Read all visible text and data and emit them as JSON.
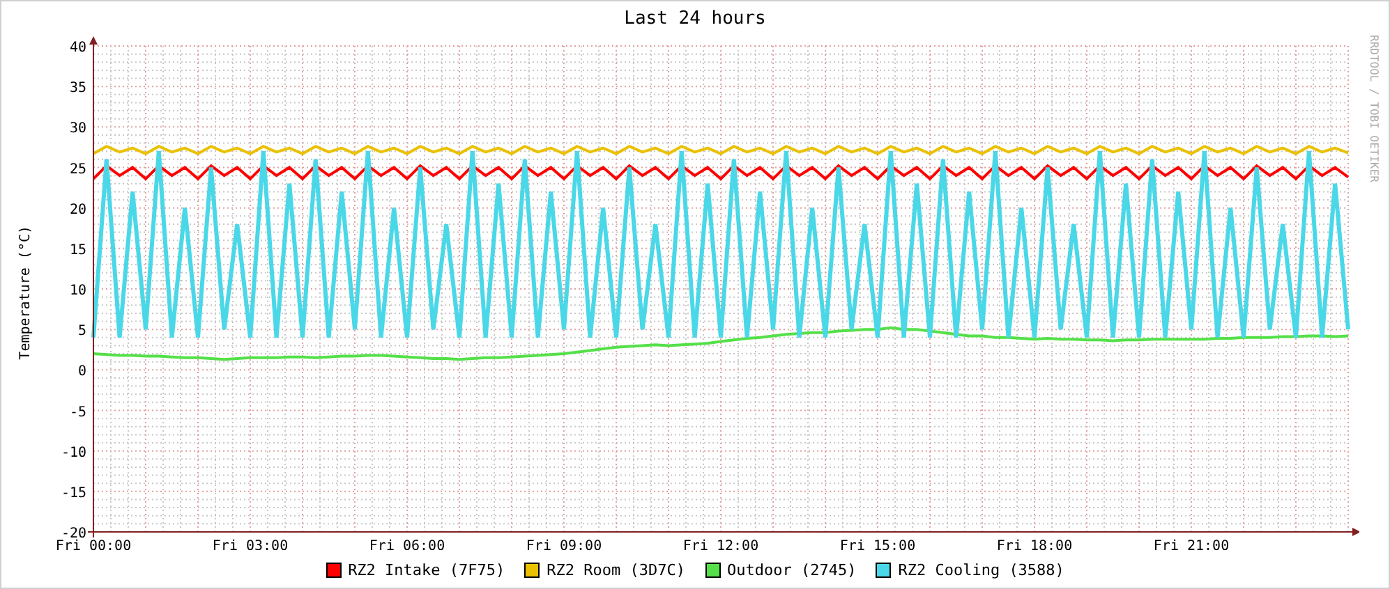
{
  "graph": {
    "credit": "RRDTOOL / TOBI OETIKER",
    "chart_data": {
      "type": "line",
      "title": "Last 24 hours",
      "ylabel": "Temperature (°C)",
      "categories": [
        "Fri 00:00",
        null,
        null,
        null,
        null,
        null,
        null,
        null,
        null,
        null,
        null,
        null,
        "Fri 03:00",
        null,
        null,
        null,
        null,
        null,
        null,
        null,
        null,
        null,
        null,
        null,
        "Fri 06:00",
        null,
        null,
        null,
        null,
        null,
        null,
        null,
        null,
        null,
        null,
        null,
        "Fri 09:00",
        null,
        null,
        null,
        null,
        null,
        null,
        null,
        null,
        null,
        null,
        null,
        "Fri 12:00",
        null,
        null,
        null,
        null,
        null,
        null,
        null,
        null,
        null,
        null,
        null,
        "Fri 15:00",
        null,
        null,
        null,
        null,
        null,
        null,
        null,
        null,
        null,
        null,
        null,
        "Fri 18:00",
        null,
        null,
        null,
        null,
        null,
        null,
        null,
        null,
        null,
        null,
        null,
        "Fri 21:00",
        null,
        null,
        null,
        null,
        null,
        null,
        null,
        null,
        null,
        null,
        null,
        null
      ],
      "ylim": [
        -20,
        40
      ],
      "grid": true,
      "yticks": [
        -20,
        -15,
        -10,
        -5,
        0,
        5,
        10,
        15,
        20,
        25,
        30,
        35,
        40
      ],
      "series": [
        {
          "name": "RZ2 Intake (7F75)",
          "color": "#ff0000",
          "values": [
            23.6,
            25.2,
            24.0,
            25.0,
            23.6,
            25.2,
            24.0,
            25.0,
            23.6,
            25.2,
            24.0,
            25.0,
            23.6,
            25.2,
            24.0,
            25.0,
            23.6,
            25.2,
            24.0,
            25.0,
            23.6,
            25.2,
            24.0,
            25.0,
            23.6,
            25.2,
            24.0,
            25.0,
            23.6,
            25.2,
            24.0,
            25.0,
            23.6,
            25.2,
            24.0,
            25.0,
            23.6,
            25.2,
            24.0,
            25.0,
            23.6,
            25.2,
            24.0,
            25.0,
            23.6,
            25.2,
            24.0,
            25.0,
            23.6,
            25.2,
            24.0,
            25.0,
            23.6,
            25.2,
            24.0,
            25.0,
            23.6,
            25.2,
            24.0,
            25.0,
            23.6,
            25.2,
            24.0,
            25.0,
            23.6,
            25.2,
            24.0,
            25.0,
            23.6,
            25.2,
            24.0,
            25.0,
            23.6,
            25.2,
            24.0,
            25.0,
            23.6,
            25.2,
            24.0,
            25.0,
            23.6,
            25.2,
            24.0,
            25.0,
            23.6,
            25.2,
            24.0,
            25.0,
            23.6,
            25.2,
            24.0,
            25.0,
            23.6,
            25.2,
            24.0,
            25.0,
            23.8
          ]
        },
        {
          "name": "RZ2 Room (3D7C)",
          "color": "#eac100",
          "values": [
            26.7,
            27.6,
            26.9,
            27.4,
            26.7,
            27.6,
            26.9,
            27.4,
            26.7,
            27.6,
            26.9,
            27.4,
            26.7,
            27.6,
            26.9,
            27.4,
            26.7,
            27.6,
            26.9,
            27.4,
            26.7,
            27.6,
            26.9,
            27.4,
            26.7,
            27.6,
            26.9,
            27.4,
            26.7,
            27.6,
            26.9,
            27.4,
            26.7,
            27.6,
            26.9,
            27.4,
            26.7,
            27.6,
            26.9,
            27.4,
            26.7,
            27.6,
            26.9,
            27.4,
            26.7,
            27.6,
            26.9,
            27.4,
            26.7,
            27.6,
            26.9,
            27.4,
            26.7,
            27.6,
            26.9,
            27.4,
            26.7,
            27.6,
            26.9,
            27.4,
            26.7,
            27.6,
            26.9,
            27.4,
            26.7,
            27.6,
            26.9,
            27.4,
            26.7,
            27.6,
            26.9,
            27.4,
            26.7,
            27.6,
            26.9,
            27.4,
            26.7,
            27.6,
            26.9,
            27.4,
            26.7,
            27.6,
            26.9,
            27.4,
            26.7,
            27.6,
            26.9,
            27.4,
            26.7,
            27.6,
            26.9,
            27.4,
            26.7,
            27.6,
            26.9,
            27.4,
            26.8
          ]
        },
        {
          "name": "Outdoor (2745)",
          "color": "#54e048",
          "values": [
            2.0,
            1.9,
            1.8,
            1.8,
            1.7,
            1.7,
            1.6,
            1.5,
            1.5,
            1.4,
            1.3,
            1.4,
            1.5,
            1.5,
            1.5,
            1.6,
            1.6,
            1.5,
            1.6,
            1.7,
            1.7,
            1.8,
            1.8,
            1.7,
            1.6,
            1.5,
            1.4,
            1.4,
            1.3,
            1.4,
            1.5,
            1.5,
            1.6,
            1.7,
            1.8,
            1.9,
            2.0,
            2.2,
            2.4,
            2.6,
            2.8,
            2.9,
            3.0,
            3.1,
            3.0,
            3.1,
            3.2,
            3.3,
            3.5,
            3.7,
            3.9,
            4.0,
            4.2,
            4.4,
            4.5,
            4.6,
            4.6,
            4.8,
            4.9,
            5.0,
            5.0,
            5.2,
            5.0,
            5.0,
            4.8,
            4.6,
            4.4,
            4.2,
            4.2,
            4.0,
            4.0,
            3.9,
            3.8,
            3.9,
            3.8,
            3.8,
            3.7,
            3.7,
            3.6,
            3.7,
            3.7,
            3.8,
            3.8,
            3.8,
            3.8,
            3.8,
            3.9,
            3.9,
            4.0,
            4.0,
            4.0,
            4.1,
            4.1,
            4.2,
            4.2,
            4.1,
            4.2
          ]
        },
        {
          "name": "RZ2 Cooling (3588)",
          "color": "#4ad8e8",
          "values": [
            4,
            26,
            4,
            22,
            5,
            27,
            4,
            20,
            4,
            25,
            5,
            18,
            4,
            27,
            4,
            23,
            4,
            26,
            4,
            22,
            5,
            27,
            4,
            20,
            4,
            25,
            5,
            18,
            4,
            27,
            4,
            23,
            4,
            26,
            4,
            22,
            5,
            27,
            4,
            20,
            4,
            25,
            5,
            18,
            4,
            27,
            4,
            23,
            4,
            26,
            4,
            22,
            5,
            27,
            4,
            20,
            4,
            25,
            5,
            18,
            4,
            27,
            4,
            23,
            4,
            26,
            4,
            22,
            5,
            27,
            4,
            20,
            4,
            25,
            5,
            18,
            4,
            27,
            4,
            23,
            4,
            26,
            4,
            22,
            5,
            27,
            4,
            20,
            4,
            25,
            5,
            18,
            4,
            27,
            4,
            23,
            5
          ]
        }
      ]
    }
  }
}
